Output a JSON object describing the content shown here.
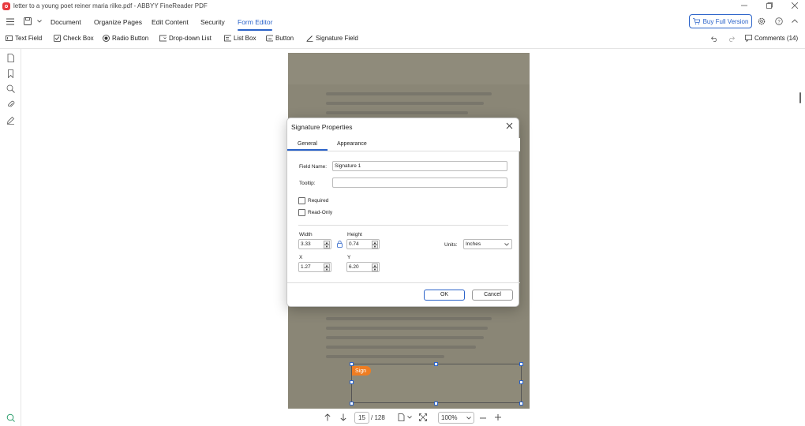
{
  "window": {
    "title": "letter to a young poet reiner maria rilke.pdf - ABBYY FineReader PDF"
  },
  "menu": {
    "items": [
      "Document",
      "Organize Pages",
      "Edit Content",
      "Security",
      "Form Editor"
    ],
    "active": "Form Editor",
    "buy_label": "Buy Full Version"
  },
  "toolbar": {
    "tools": [
      "Text Field",
      "Check Box",
      "Radio Button",
      "Drop-down List",
      "List Box",
      "Button",
      "Signature Field"
    ],
    "comments_label": "Comments (14)"
  },
  "signature_field": {
    "badge": "Sign"
  },
  "bottom": {
    "current_page": "15",
    "total_pages": "/ 128",
    "zoom": "100%"
  },
  "dialog": {
    "title": "Signature Properties",
    "tabs": [
      "General",
      "Appearance"
    ],
    "active_tab": "General",
    "field_name_label": "Field Name:",
    "field_name_value": "Signature 1",
    "tooltip_label": "Tooltip:",
    "tooltip_value": "",
    "required_label": "Required",
    "readonly_label": "Read-Only",
    "width_label": "Width",
    "width_value": "3.33",
    "height_label": "Height",
    "height_value": "0.74",
    "x_label": "X",
    "x_value": "1.27",
    "y_label": "Y",
    "y_value": "6.20",
    "units_label": "Units:",
    "units_value": "Inches",
    "ok_label": "OK",
    "cancel_label": "Cancel"
  },
  "colors": {
    "accent": "#2b63c9",
    "sign_badge": "#ef7d22",
    "app_logo": "#e8383d"
  }
}
